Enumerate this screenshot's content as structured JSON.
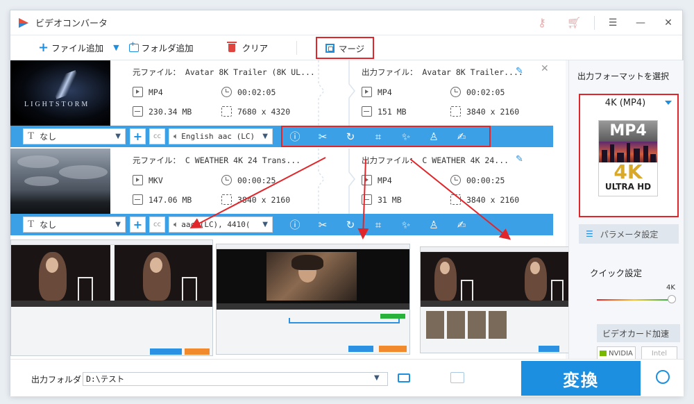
{
  "app": {
    "title": "ビデオコンバータ"
  },
  "toolbar": {
    "add_file": "ファイル追加",
    "add_folder": "フォルダ追加",
    "clear": "クリア",
    "merge": "マージ"
  },
  "files": [
    {
      "source_title": "元ファイル： Avatar 8K Trailer (8K UL...",
      "source": {
        "format": "MP4",
        "duration": "00:02:05",
        "size": "230.34 MB",
        "resolution": "7680 x 4320"
      },
      "output_title": "出力ファイル： Avatar 8K Trailer....",
      "output": {
        "format": "MP4",
        "duration": "00:02:05",
        "size": "151 MB",
        "resolution": "3840 x 2160"
      },
      "subtitle": "なし",
      "audio": "English aac (LC)",
      "thumb_text": "LIGHTSTORM"
    },
    {
      "source_title": "元ファイル： C  WEATHER  4K 24  Trans...",
      "source": {
        "format": "MKV",
        "duration": "00:00:25",
        "size": "147.06 MB",
        "resolution": "3840 x 2160"
      },
      "output_title": "出力ファイル： C  WEATHER  4K 24...",
      "output": {
        "format": "MP4",
        "duration": "00:00:25",
        "size": "31 MB",
        "resolution": "3840 x 2160"
      },
      "subtitle": "なし",
      "audio": "aac (LC), 4410("
    }
  ],
  "right_panel": {
    "output_format_label": "出力フォーマットを選択",
    "format_name": "4K (MP4)",
    "format_badge_top": "MP4",
    "format_badge_4k": "4K",
    "format_badge_bottom": "ULTRA HD",
    "param_settings": "パラメータ設定",
    "quick_settings": "クイック設定",
    "quality_max_label": "4K",
    "gpu_accel": "ビデオカード加速",
    "nvidia": "NVIDIA",
    "intel": "Intel"
  },
  "bottom": {
    "output_folder_label": "出力フォルダ：",
    "output_folder_value": "D:\\テスト",
    "convert": "変換"
  },
  "colors": {
    "accent": "#1d8fe1",
    "highlight_red": "#e0262b",
    "bar_blue": "#3ca0e6"
  }
}
